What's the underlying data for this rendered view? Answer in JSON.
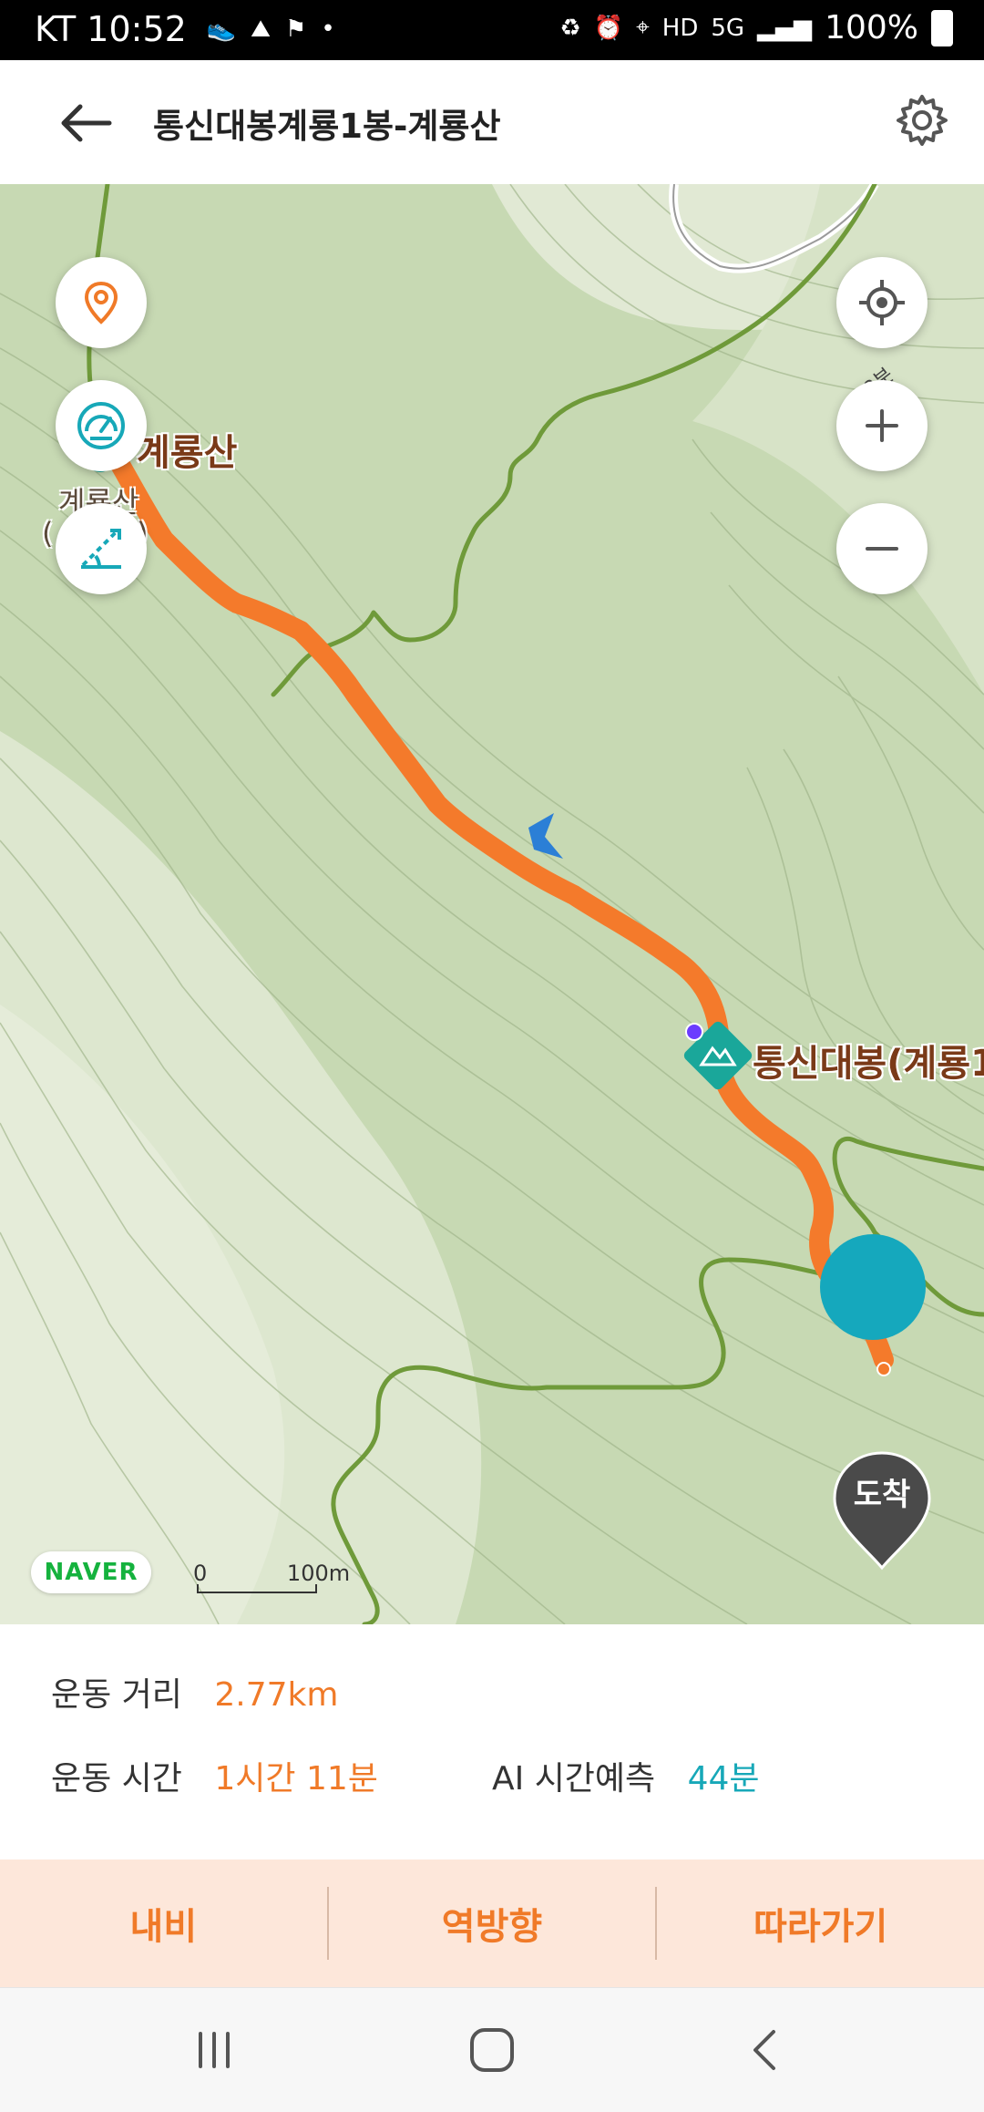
{
  "status": {
    "carrier": "KT",
    "time": "10:52",
    "battery": "100%",
    "network": "5G",
    "hd": "HD"
  },
  "header": {
    "title": "통신대봉계룡1봉-계룡산"
  },
  "map": {
    "labels": {
      "peak_main": "계룡산",
      "peak_small_1": "계룡산",
      "peak_small_2": "(",
      "peak_small_3": ")",
      "summit": "통신대봉(계룡1",
      "road": "<-18분"
    },
    "arrival_label": "도착",
    "naver_logo": "NAVER",
    "scale_start": "0",
    "scale_end": "100m"
  },
  "info": {
    "distance_label": "운동 거리",
    "distance_value": "2.77km",
    "time_label": "운동 시간",
    "time_value": "1시간 11분",
    "ai_label": "AI 시간예측",
    "ai_value": "44분"
  },
  "actions": {
    "navigate": "내비",
    "reverse": "역방향",
    "follow": "따라가기"
  },
  "colors": {
    "accent_orange": "#f07a28",
    "accent_teal": "#17a8b8",
    "route": "#f47a2b",
    "trail": "#6f9a3a"
  }
}
